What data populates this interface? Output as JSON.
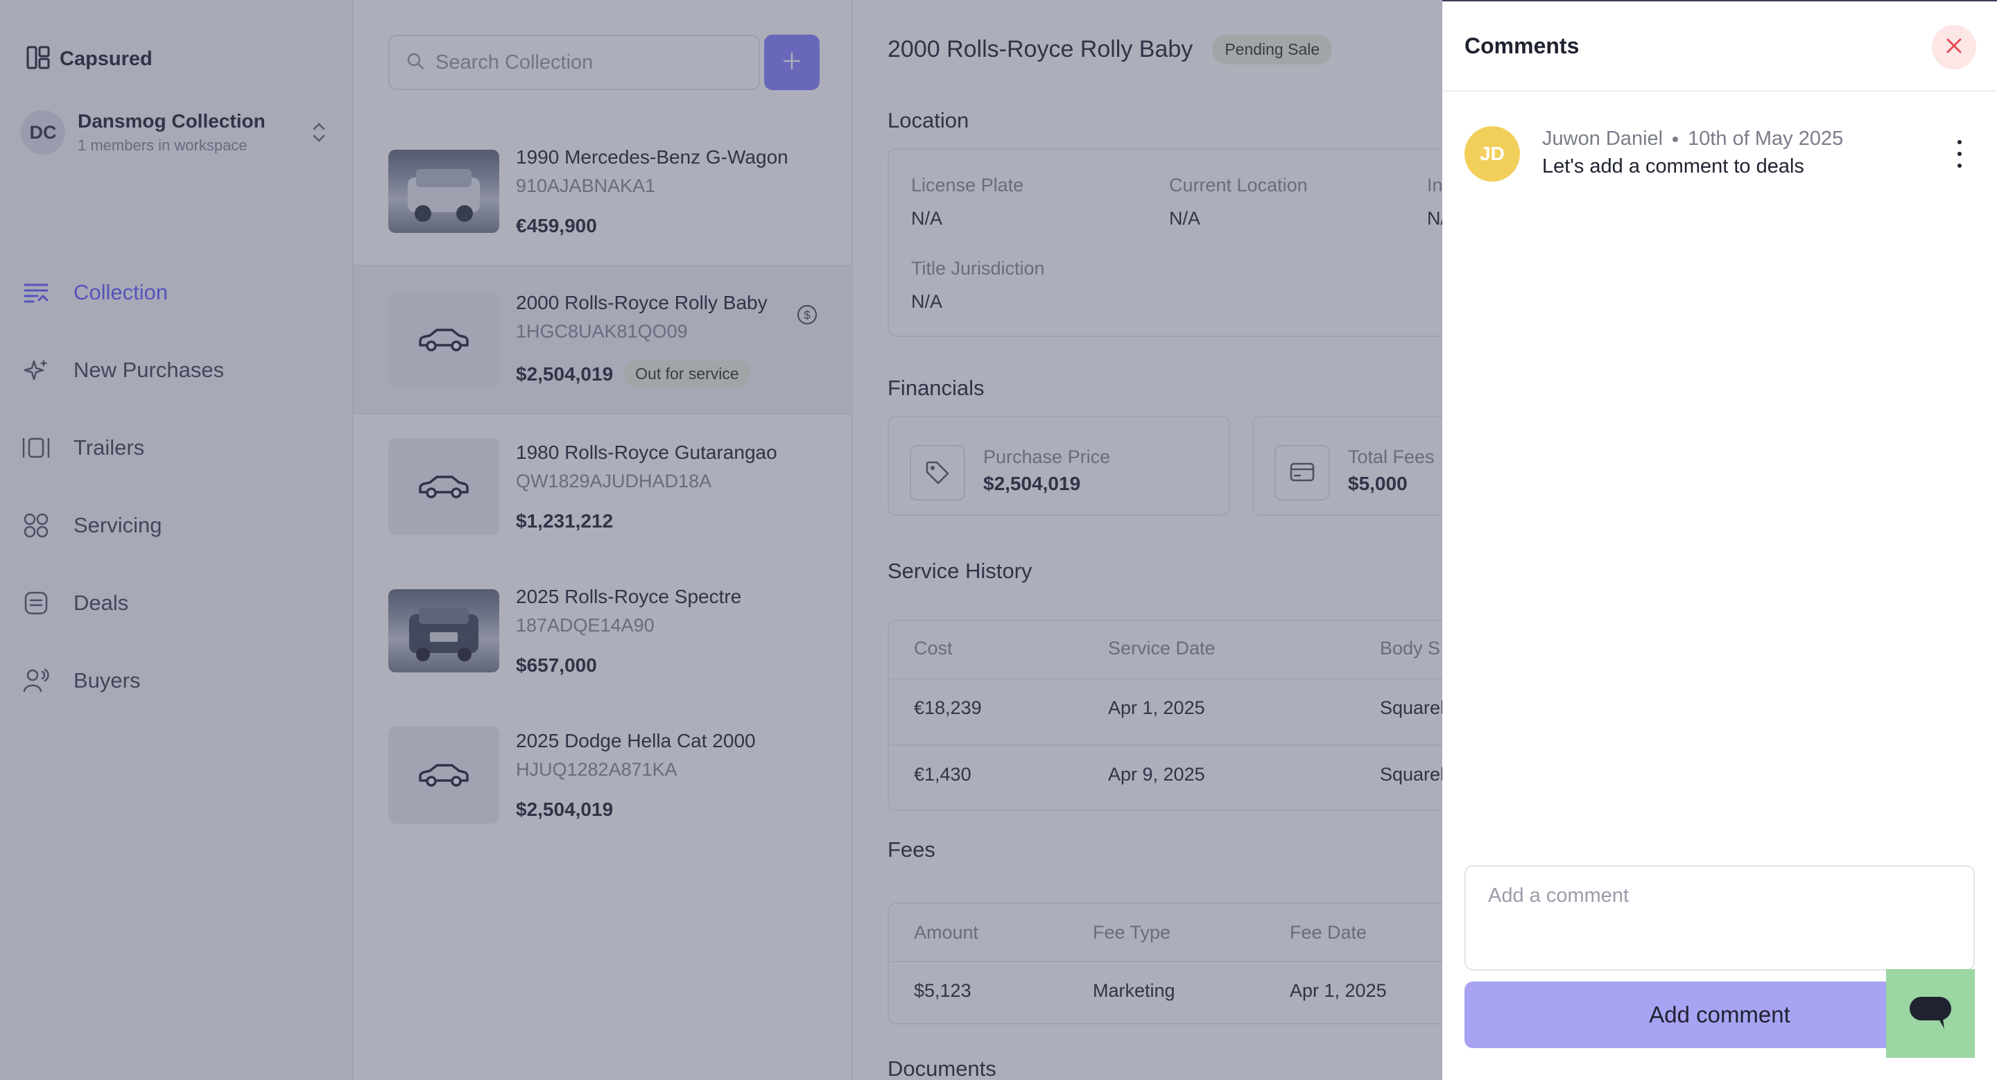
{
  "app": {
    "brand": "Capsured"
  },
  "workspace": {
    "initials": "DC",
    "name": "Dansmog Collection",
    "subtitle": "1 members in workspace"
  },
  "nav": [
    {
      "label": "Collection",
      "icon": "collection-icon",
      "active": true
    },
    {
      "label": "New Purchases",
      "icon": "sparkle-icon"
    },
    {
      "label": "Trailers",
      "icon": "trailer-icon"
    },
    {
      "label": "Servicing",
      "icon": "grid-icon"
    },
    {
      "label": "Deals",
      "icon": "deals-icon"
    },
    {
      "label": "Buyers",
      "icon": "buyers-icon"
    }
  ],
  "search": {
    "placeholder": "Search Collection"
  },
  "vehicles": [
    {
      "title": "1990 Mercedes-Benz G-Wagon",
      "vin": "910AJABNAKA1",
      "price": "€459,900",
      "photo": true
    },
    {
      "title": "2000 Rolls-Royce Rolly Baby",
      "vin": "1HGC8UAK81QO09",
      "price": "$2,504,019",
      "tag": "Out for service",
      "selected": true
    },
    {
      "title": "1980 Rolls-Royce Gutarangao",
      "vin": "QW1829AJUDHAD18A",
      "price": "$1,231,212"
    },
    {
      "title": "2025 Rolls-Royce Spectre",
      "vin": "187ADQE14A90",
      "price": "$657,000",
      "photo": true
    },
    {
      "title": "2025 Dodge Hella Cat 2000",
      "vin": "HJUQ1282A871KA",
      "price": "$2,504,019"
    }
  ],
  "detail": {
    "title": "2000 Rolls-Royce Rolly Baby",
    "status": "Pending Sale",
    "location": {
      "heading": "Location",
      "license_plate_label": "License Plate",
      "license_plate": "N/A",
      "current_location_label": "Current Location",
      "current_location": "N/A",
      "third_label": "In",
      "third_value": "N/",
      "title_jurisdiction_label": "Title Jurisdiction",
      "title_jurisdiction": "N/A"
    },
    "financials": {
      "heading": "Financials",
      "purchase_price_label": "Purchase Price",
      "purchase_price": "$2,504,019",
      "total_fees_label": "Total Fees",
      "total_fees": "$5,000"
    },
    "service_history": {
      "heading": "Service History",
      "columns": [
        "Cost",
        "Service Date",
        "Body S"
      ],
      "rows": [
        [
          "€18,239",
          "Apr 1, 2025",
          "Squarel"
        ],
        [
          "€1,430",
          "Apr 9, 2025",
          "Squarel"
        ]
      ]
    },
    "fees": {
      "heading": "Fees",
      "columns": [
        "Amount",
        "Fee Type",
        "Fee Date"
      ],
      "rows": [
        [
          "$5,123",
          "Marketing",
          "Apr 1, 2025"
        ]
      ]
    },
    "documents_heading": "Documents"
  },
  "comments_panel": {
    "title": "Comments",
    "comments": [
      {
        "initials": "JD",
        "author": "Juwon Daniel",
        "date": "10th of May 2025",
        "text": "Let's add a comment to deals"
      }
    ],
    "input_placeholder": "Add a comment",
    "submit_label": "Add comment"
  },
  "colors": {
    "accent": "#6c63ff",
    "submit": "#a8a3f2",
    "avatar": "#f2cf5b",
    "close_bg": "#fde6e6",
    "close_icon": "#e5484d",
    "chat": "#9bd6a3"
  }
}
